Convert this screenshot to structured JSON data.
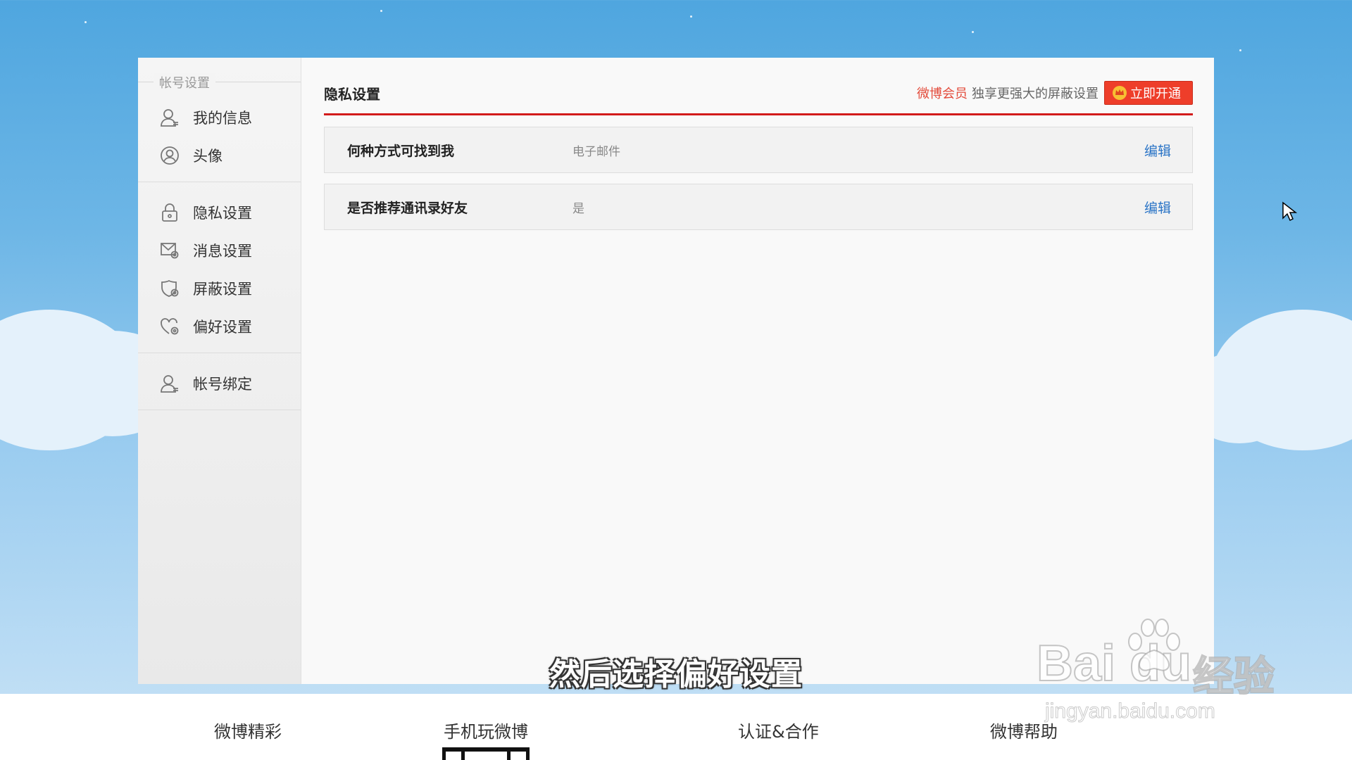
{
  "sidebar": {
    "section_title": "帐号设置",
    "group1": [
      {
        "label": "我的信息",
        "icon": "person-icon"
      },
      {
        "label": "头像",
        "icon": "avatar-icon"
      }
    ],
    "group2": [
      {
        "label": "隐私设置",
        "icon": "lock-icon"
      },
      {
        "label": "消息设置",
        "icon": "message-gear-icon"
      },
      {
        "label": "屏蔽设置",
        "icon": "shield-gear-icon"
      },
      {
        "label": "偏好设置",
        "icon": "heart-gear-icon"
      }
    ],
    "group3": [
      {
        "label": "帐号绑定",
        "icon": "person-bind-icon"
      }
    ]
  },
  "main": {
    "title": "隐私设置",
    "vip_name": "微博会员",
    "vip_desc": "独享更强大的屏蔽设置",
    "vip_button": "立即开通",
    "rows": [
      {
        "label": "何种方式可找到我",
        "value": "电子邮件",
        "action": "编辑"
      },
      {
        "label": "是否推荐通讯录好友",
        "value": "是",
        "action": "编辑"
      }
    ]
  },
  "footer": {
    "columns": [
      "微博精彩",
      "手机玩微博",
      "认证&合作",
      "微博帮助"
    ]
  },
  "overlay": {
    "subtitle": "然后选择偏好设置",
    "watermark_logo": "Bai du",
    "watermark_product": "经验",
    "watermark_url": "jingyan.baidu.com"
  },
  "colors": {
    "accent_red": "#d21b1b",
    "link_blue": "#2a74c6",
    "vip_button": "#ee3e2a",
    "sky": "#4fa6df"
  }
}
